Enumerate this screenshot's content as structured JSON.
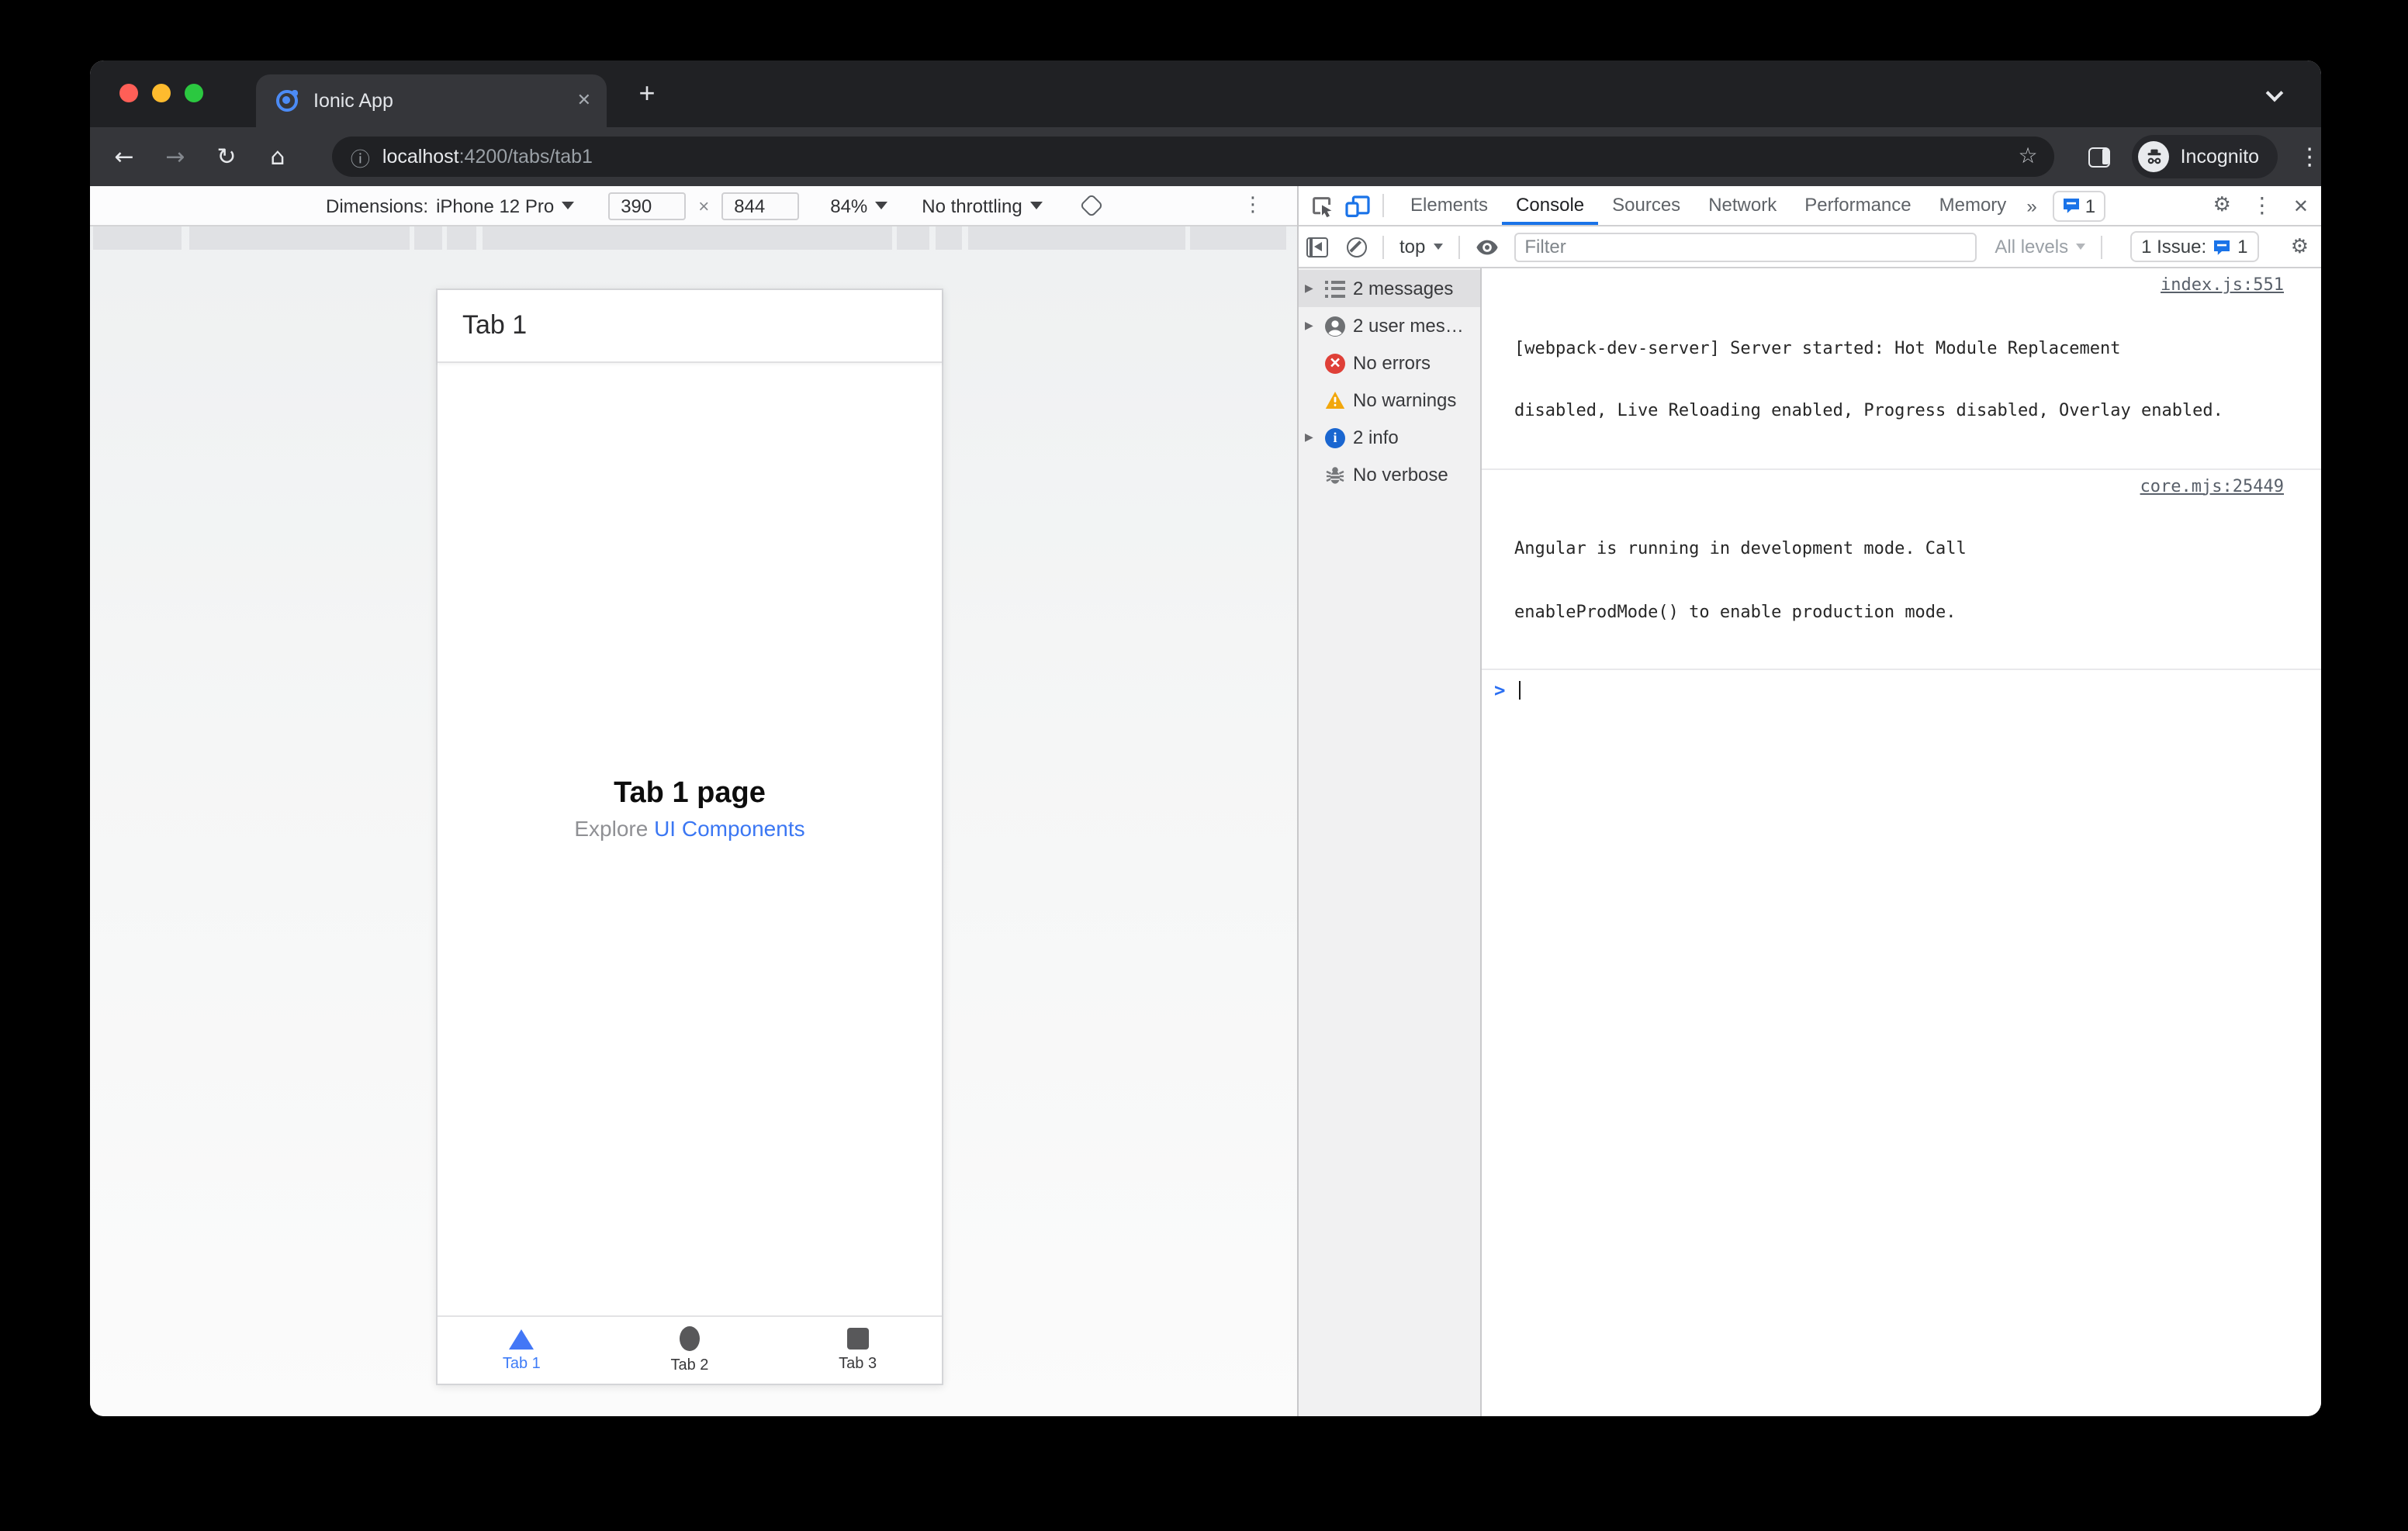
{
  "window": {
    "tab_title": "Ionic App",
    "close_glyph": "✕",
    "new_tab_glyph": "+"
  },
  "urlbar": {
    "info_glyph": "ⓘ",
    "host": "localhost",
    "rest": ":4200/tabs/tab1",
    "star_glyph": "☆",
    "incognito_label": "Incognito",
    "back_glyph": "←",
    "forward_glyph": "→",
    "reload_glyph": "↻",
    "home_glyph": "⌂",
    "menu_glyph": "⋮"
  },
  "device_toolbar": {
    "label": "Dimensions:",
    "device": "iPhone 12 Pro",
    "width": "390",
    "separator": "×",
    "height": "844",
    "zoom": "84%",
    "throttle": "No throttling",
    "menu_glyph": "⋮"
  },
  "devtools": {
    "tabs": [
      "Elements",
      "Console",
      "Sources",
      "Network",
      "Performance",
      "Memory"
    ],
    "more_glyph": "»",
    "tab_badge_count": "1",
    "gear_glyph": "⚙",
    "menu_glyph": "⋮",
    "close_glyph": "✕",
    "toolbar": {
      "context": "top",
      "filter_placeholder": "Filter",
      "levels": "All levels",
      "issues_label": "1 Issue:",
      "issues_count": "1"
    },
    "sidebar": {
      "items": [
        {
          "label": "2 messages"
        },
        {
          "label": "2 user mes…"
        },
        {
          "label": "No errors"
        },
        {
          "label": "No warnings"
        },
        {
          "label": "2 info"
        },
        {
          "label": "No verbose"
        }
      ],
      "expander_glyph": "▶"
    },
    "messages": [
      {
        "line1": "[webpack-dev-server] Server started: Hot Module Replacement",
        "line2": "disabled, Live Reloading enabled, Progress disabled, Overlay enabled.",
        "source": "index.js:551"
      },
      {
        "line1": "Angular is running in development mode. Call",
        "line2": "enableProdMode() to enable production mode.",
        "source": "core.mjs:25449"
      }
    ],
    "prompt_glyph": ">"
  },
  "app": {
    "header_title": "Tab 1",
    "heading": "Tab 1 page",
    "explore_prefix": "Explore ",
    "explore_link": "UI Components",
    "tabs": [
      {
        "label": "Tab 1"
      },
      {
        "label": "Tab 2"
      },
      {
        "label": "Tab 3"
      }
    ]
  },
  "colors": {
    "devtools_accent": "#1a73e8",
    "ionic_primary": "#3d7bf7",
    "error_red": "#df4038",
    "warning_yellow": "#f2a70c",
    "info_blue": "#1a66d0",
    "chrome_dark": "#202124",
    "chrome_toolbar": "#35363a"
  }
}
